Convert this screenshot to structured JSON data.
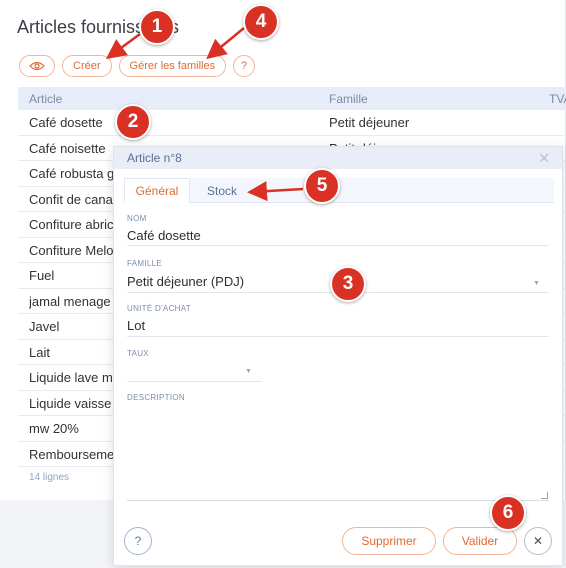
{
  "page": {
    "title": "Articles fournisseurs"
  },
  "toolbar": {
    "view_icon": "eye-icon",
    "create_label": "Créer",
    "manage_families_label": "Gérer les familles",
    "help_label": "?"
  },
  "table": {
    "columns": [
      "Article",
      "Famille",
      "TVA"
    ],
    "rows": [
      {
        "article": "Café dosette",
        "famille": "Petit déjeuner"
      },
      {
        "article": "Café noisette",
        "famille": "Petit déjeuner"
      },
      {
        "article": "Café robusta g",
        "famille": ""
      },
      {
        "article": "Confit de cana",
        "famille": ""
      },
      {
        "article": "Confiture abric",
        "famille": ""
      },
      {
        "article": "Confiture Melo",
        "famille": ""
      },
      {
        "article": "Fuel",
        "famille": ""
      },
      {
        "article": "jamal menage",
        "famille": ""
      },
      {
        "article": "Javel",
        "famille": ""
      },
      {
        "article": "Lait",
        "famille": ""
      },
      {
        "article": "Liquide lave m",
        "famille": ""
      },
      {
        "article": "Liquide vaisse",
        "famille": ""
      },
      {
        "article": "mw 20%",
        "famille": ""
      },
      {
        "article": "Rembourseme",
        "famille": ""
      }
    ],
    "row_count": "14 lignes"
  },
  "modal": {
    "title": "Article n°8",
    "close_icon": "close-icon",
    "tabs": [
      "Général",
      "Stock"
    ],
    "active_tab": "Général",
    "fields": {
      "nom": {
        "label": "NOM",
        "value": "Café dosette"
      },
      "famille": {
        "label": "FAMILLE",
        "value": "Petit déjeuner (PDJ)"
      },
      "unite": {
        "label": "UNITÉ D'ACHAT",
        "value": "Lot"
      },
      "taux": {
        "label": "TAUX",
        "value": ""
      },
      "description": {
        "label": "DESCRIPTION",
        "value": ""
      }
    },
    "buttons": {
      "help": "?",
      "delete": "Supprimer",
      "validate": "Valider",
      "close": "✕"
    }
  },
  "annotations": {
    "markers": [
      "1",
      "2",
      "3",
      "4",
      "5",
      "6"
    ],
    "color": "#d93225"
  }
}
